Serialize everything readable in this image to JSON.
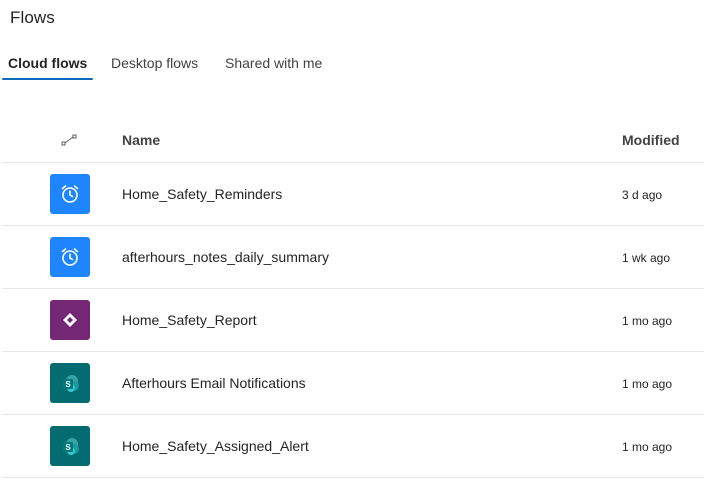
{
  "page": {
    "title": "Flows"
  },
  "tabs": [
    {
      "label": "Cloud flows",
      "active": true
    },
    {
      "label": "Desktop flows",
      "active": false
    },
    {
      "label": "Shared with me",
      "active": false
    }
  ],
  "table": {
    "columns": {
      "type_icon": "flow-type-icon",
      "name": "Name",
      "modified": "Modified"
    },
    "rows": [
      {
        "icon": "alarm-clock-icon",
        "color": "#1f85ff",
        "name": "Home_Safety_Reminders",
        "modified": "3 d ago"
      },
      {
        "icon": "alarm-clock-icon",
        "color": "#1f85ff",
        "name": "afterhours_notes_daily_summary",
        "modified": "1 wk ago"
      },
      {
        "icon": "power-apps-icon",
        "color": "#742774",
        "name": "Home_Safety_Report",
        "modified": "1 mo ago"
      },
      {
        "icon": "sharepoint-icon",
        "color": "#036c70",
        "name": "Afterhours Email Notifications",
        "modified": "1 mo ago"
      },
      {
        "icon": "sharepoint-icon",
        "color": "#036c70",
        "name": "Home_Safety_Assigned_Alert",
        "modified": "1 mo ago"
      }
    ]
  },
  "colors": {
    "accent": "#0f6cbd",
    "scheduled": "#1f85ff",
    "powerapps": "#742774",
    "sharepoint": "#036c70"
  }
}
